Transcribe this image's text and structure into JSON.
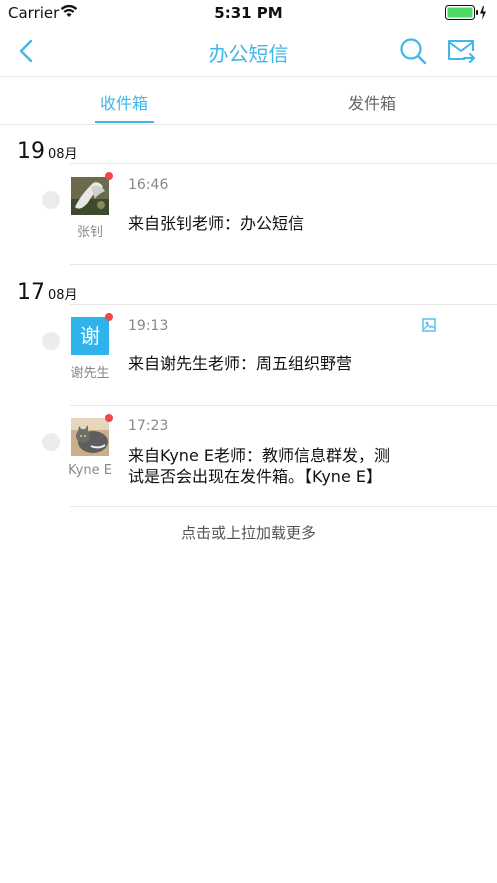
{
  "status_bar": {
    "carrier": "Carrier",
    "time": "5:31 PM"
  },
  "nav": {
    "title": "办公短信",
    "back_icon": "chevron-left-icon",
    "search_icon": "search-icon",
    "compose_icon": "mail-forward-icon"
  },
  "tabs": [
    {
      "label": "收件箱",
      "active": true
    },
    {
      "label": "发件箱",
      "active": false
    }
  ],
  "colors": {
    "accent": "#3fb7ea",
    "unread_dot": "#f04848",
    "avatar_bg": "#2eb3ea"
  },
  "groups": [
    {
      "day": "19",
      "month": "08月",
      "messages": [
        {
          "sender": "张钊",
          "time": "16:46",
          "text": "来自张钊老师：办公短信",
          "unread": true,
          "avatar_type": "photo",
          "has_attachment": false
        }
      ]
    },
    {
      "day": "17",
      "month": "08月",
      "messages": [
        {
          "sender": "谢先生",
          "time": "19:13",
          "text": "来自谢先生老师：周五组织野营",
          "unread": true,
          "avatar_type": "char",
          "avatar_char": "谢",
          "has_attachment": true
        },
        {
          "sender": "Kyne E",
          "time": "17:23",
          "text": "来自Kyne E老师：教师信息群发，测试是否会出现在发件箱。【Kyne E】",
          "unread": true,
          "avatar_type": "photo",
          "has_attachment": false
        }
      ]
    }
  ],
  "load_more": "点击或上拉加载更多"
}
